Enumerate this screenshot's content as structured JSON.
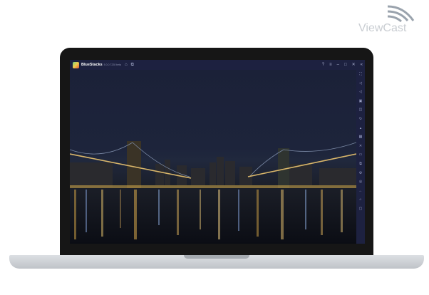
{
  "brand": {
    "logo_text": "ViewCast"
  },
  "emulator": {
    "app_name": "BlueStacks",
    "version": "5.0.0.7228 beta",
    "titlebar_icons": [
      "home-icon",
      "multi-instance-icon"
    ],
    "window_controls": [
      "help-icon",
      "menu-icon",
      "minimize-icon",
      "maximize-icon",
      "close-icon",
      "collapse-icon"
    ],
    "sidebar_icons": [
      "fullscreen-icon",
      "volume-up-icon",
      "volume-down-icon",
      "record-icon",
      "screenshot-icon",
      "rotate-icon",
      "shake-icon",
      "keymap-icon",
      "location-icon",
      "folder-icon",
      "copy-icon",
      "settings-gear-icon",
      "eco-mode-icon",
      "back-icon",
      "home-icon",
      "recent-apps-icon"
    ]
  },
  "colors": {
    "titlebar": "#1d2140",
    "laptop_bezel": "#161616",
    "laptop_base": "#cfd3d7"
  }
}
